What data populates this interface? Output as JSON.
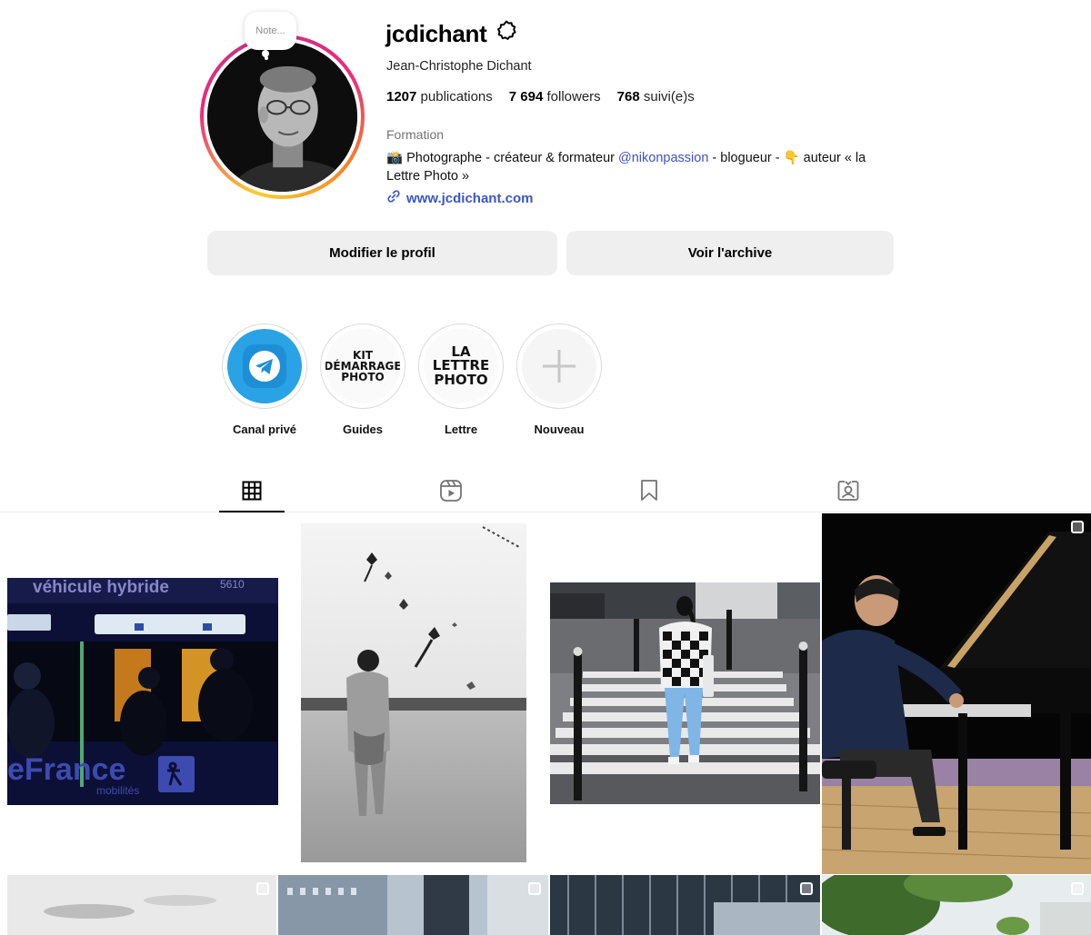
{
  "profile": {
    "note_label": "Note...",
    "username": "jcdichant",
    "full_name": "Jean-Christophe Dichant",
    "stats": {
      "posts_count": "1207",
      "posts_label": "publications",
      "followers_count": "7 694",
      "followers_label": "followers",
      "following_count": "768",
      "following_label": "suivi(e)s"
    },
    "category": "Formation",
    "bio_part1": "📸 Photographe - créateur & formateur ",
    "bio_mention": "@nikonpassion",
    "bio_part2": " - blogueur - 👇 auteur « la Lettre Photo »",
    "website": "www.jcdichant.com"
  },
  "buttons": {
    "edit_profile": "Modifier le profil",
    "view_archive": "Voir l'archive"
  },
  "highlights": [
    {
      "label": "Canal privé",
      "icon": "telegram-icon"
    },
    {
      "label": "Guides",
      "cover_text": [
        "KIT",
        "DÉMARRAGE",
        "PHOTO"
      ]
    },
    {
      "label": "Lettre",
      "cover_text": [
        "LA",
        "LETTRE",
        "PHOTO"
      ]
    },
    {
      "label": "Nouveau",
      "icon": "plus-icon"
    }
  ],
  "tabs": [
    {
      "name": "posts",
      "icon": "grid-icon",
      "active": true
    },
    {
      "name": "reels",
      "icon": "reels-icon"
    },
    {
      "name": "saved",
      "icon": "bookmark-icon"
    },
    {
      "name": "tagged",
      "icon": "tagged-user-icon"
    }
  ],
  "posts": [
    {
      "subject": "bus",
      "text_top": "véhicule hybride",
      "text_code": "5610",
      "text_brand": "eFrance",
      "text_sub": "mobilités"
    },
    {
      "subject": "kites-beach"
    },
    {
      "subject": "crosswalk"
    },
    {
      "subject": "pianist",
      "multiple": true
    }
  ],
  "colors": {
    "accent_link": "#3a56c9",
    "mention": "#4150c8",
    "button_bg": "#efefef",
    "telegram": "#2aa3e6"
  }
}
